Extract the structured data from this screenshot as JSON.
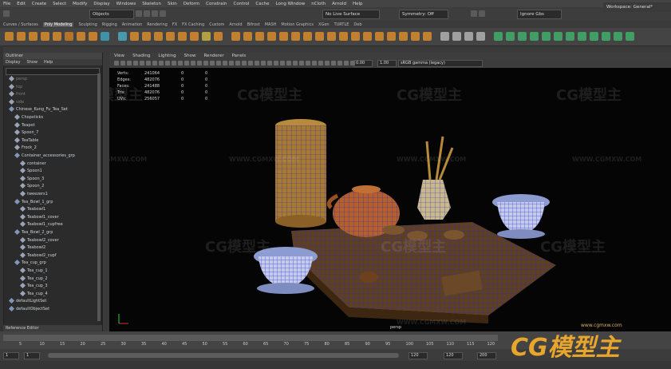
{
  "menubar": {
    "items": [
      "File",
      "Edit",
      "Create",
      "Select",
      "Modify",
      "Display",
      "Windows",
      "Skeleton",
      "Skin",
      "Deform",
      "Constrain",
      "Control",
      "Cache",
      "Long Window",
      "nCloth",
      "Arnold",
      "Help"
    ],
    "workspace_label": "Workspace:",
    "workspace_value": "General*"
  },
  "status": {
    "mode": "Objects",
    "live_surface": "No Live Surface",
    "symmetry": "Symmetry: Off",
    "renderer": "Ignore Gbs"
  },
  "shelf_tabs": [
    "Curves / Surfaces",
    "Poly Modeling",
    "Sculpting",
    "Rigging",
    "Animation",
    "Rendering",
    "FX",
    "FX Caching",
    "Custom",
    "Arnold",
    "Bifrost",
    "MASH",
    "Motion Graphics",
    "XGen",
    "TURTLE",
    "Deb"
  ],
  "shelf_active": "Poly Modeling",
  "outliner": {
    "title": "Outliner",
    "menu": [
      "Display",
      "Show",
      "Help"
    ],
    "items": [
      {
        "label": "persp",
        "level": 0,
        "dim": true
      },
      {
        "label": "top",
        "level": 0,
        "dim": true
      },
      {
        "label": "front",
        "level": 0,
        "dim": true
      },
      {
        "label": "side",
        "level": 0,
        "dim": true
      },
      {
        "label": "Chinese_Kung_Fu_Tea_Set",
        "level": 0,
        "dim": false
      },
      {
        "label": "Chopsticks",
        "level": 1,
        "dim": false
      },
      {
        "label": "Teapot",
        "level": 1,
        "dim": false
      },
      {
        "label": "Spoon_7",
        "level": 1,
        "dim": false
      },
      {
        "label": "TeaTable",
        "level": 1,
        "dim": false
      },
      {
        "label": "Frock_2",
        "level": 1,
        "dim": false
      },
      {
        "label": "Container_accessories_grp",
        "level": 1,
        "dim": false
      },
      {
        "label": "container",
        "level": 2,
        "dim": false
      },
      {
        "label": "Spoon1",
        "level": 2,
        "dim": false
      },
      {
        "label": "Spoon_3",
        "level": 2,
        "dim": false
      },
      {
        "label": "Spoon_2",
        "level": 2,
        "dim": false
      },
      {
        "label": "tweezers1",
        "level": 2,
        "dim": false
      },
      {
        "label": "Tea_Bowl_1_grp",
        "level": 1,
        "dim": false
      },
      {
        "label": "Teabowl1",
        "level": 2,
        "dim": false
      },
      {
        "label": "Teabowl1_cover",
        "level": 2,
        "dim": false
      },
      {
        "label": "Teabowl1_cupfree",
        "level": 2,
        "dim": false
      },
      {
        "label": "Tea_Bowl_2_grp",
        "level": 1,
        "dim": false
      },
      {
        "label": "Teabowl2_cover",
        "level": 2,
        "dim": false
      },
      {
        "label": "Teabowl2",
        "level": 2,
        "dim": false
      },
      {
        "label": "Teabowl2_cupf",
        "level": 2,
        "dim": false
      },
      {
        "label": "Tea_cup_grp",
        "level": 1,
        "dim": false
      },
      {
        "label": "Tea_cup_1",
        "level": 2,
        "dim": false
      },
      {
        "label": "Tea_cup_2",
        "level": 2,
        "dim": false
      },
      {
        "label": "Tea_cup_3",
        "level": 2,
        "dim": false
      },
      {
        "label": "Tea_cup_4",
        "level": 2,
        "dim": false
      },
      {
        "label": "defaultLightSet",
        "level": 0,
        "dim": false
      },
      {
        "label": "defaultObjectSet",
        "level": 0,
        "dim": false
      }
    ],
    "reference_editor": "Reference Editor"
  },
  "viewport": {
    "menu": [
      "View",
      "Shading",
      "Lighting",
      "Show",
      "Renderer",
      "Panels"
    ],
    "exposure": "0.00",
    "gamma": "1.00",
    "colorspace": "sRGB gamma (legacy)",
    "camera_label": "persp",
    "hud": [
      {
        "label": "Verts:",
        "v1": "241064",
        "v2": "0",
        "v3": "0"
      },
      {
        "label": "Edges:",
        "v1": "482076",
        "v2": "0",
        "v3": "0"
      },
      {
        "label": "Faces:",
        "v1": "241488",
        "v2": "0",
        "v3": "0"
      },
      {
        "label": "Tris:",
        "v1": "482076",
        "v2": "0",
        "v3": "0"
      },
      {
        "label": "UVs:",
        "v1": "256057",
        "v2": "0",
        "v3": "0"
      }
    ]
  },
  "watermark": {
    "brand": "CG模型主",
    "url": "WWW.CGMXW.COM",
    "corner_url": "www.cgmxw.com"
  },
  "timeline": {
    "frames": [
      "5",
      "10",
      "15",
      "20",
      "25",
      "30",
      "35",
      "40",
      "45",
      "50",
      "55",
      "60",
      "65",
      "70",
      "75",
      "80",
      "85",
      "90",
      "95",
      "100",
      "105",
      "110",
      "115",
      "120"
    ],
    "start": "1",
    "range_start": "1",
    "range_end": "120",
    "end": "120",
    "end2": "200"
  },
  "colors": {
    "accent": "#e69a2e",
    "selection_blue": "#6d87c8",
    "wire_blue": "#3b3bd0"
  }
}
